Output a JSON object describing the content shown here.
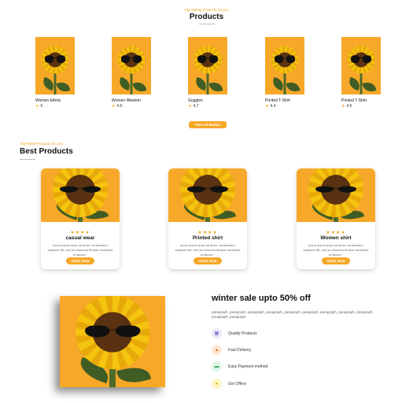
{
  "top_selling": {
    "tag": "Top Selling Products for you",
    "title": "Products",
    "view_all": "View All Button",
    "items": [
      {
        "name": "Women Ethnic",
        "rating": "5"
      },
      {
        "name": "Women Western",
        "rating": "4.5"
      },
      {
        "name": "Goggles",
        "rating": "4.7"
      },
      {
        "name": "Printed T-Shirt",
        "rating": "4.4"
      },
      {
        "name": "Printed T-Shirt",
        "rating": "4.5"
      }
    ]
  },
  "best": {
    "tag": "Top Rated Products for you",
    "title": "Best Products",
    "cards": [
      {
        "stars": "★★★★",
        "title": "casual wear",
        "desc": "lorem ipsum dolor sit amet, consectetur adipisce elit, sed do eiusmod tempor incididunt ut labour...",
        "button": "Order Now"
      },
      {
        "stars": "★★★★",
        "title": "Printed shirt",
        "desc": "lorem ipsum dolor sit amet, consectetur adipisce elit, sed do eiusmod tempor incididunt ut labour...",
        "button": "Order Now"
      },
      {
        "stars": "★★★★",
        "title": "Women shirt",
        "desc": "lorem ipsum dolor sit amet, consectetur adipisce elit, sed do eiusmod tempor incididunt ut labour...",
        "button": "Order Now"
      }
    ]
  },
  "sale": {
    "title": "winter sale upto 50% off",
    "paragraph": "paragraph, paragraph, paragraph, paragraph, paragraph, paragraph, paragraph, paragraph, paragraph, paragraph, paragraph",
    "features": [
      {
        "icon": "box-icon",
        "glyph": "▦",
        "label": "Quality Products",
        "color": "#ece6fb"
      },
      {
        "icon": "truck-icon",
        "glyph": "▲",
        "label": "Fast Delivery",
        "color": "#fde9d8"
      },
      {
        "icon": "card-icon",
        "glyph": "▬",
        "label": "Easy Payment method",
        "color": "#dff5e6"
      },
      {
        "icon": "tag-icon",
        "glyph": "●",
        "label": "Get Offers",
        "color": "#fdf7c8"
      }
    ]
  },
  "colors": {
    "accent": "#f7a829"
  }
}
